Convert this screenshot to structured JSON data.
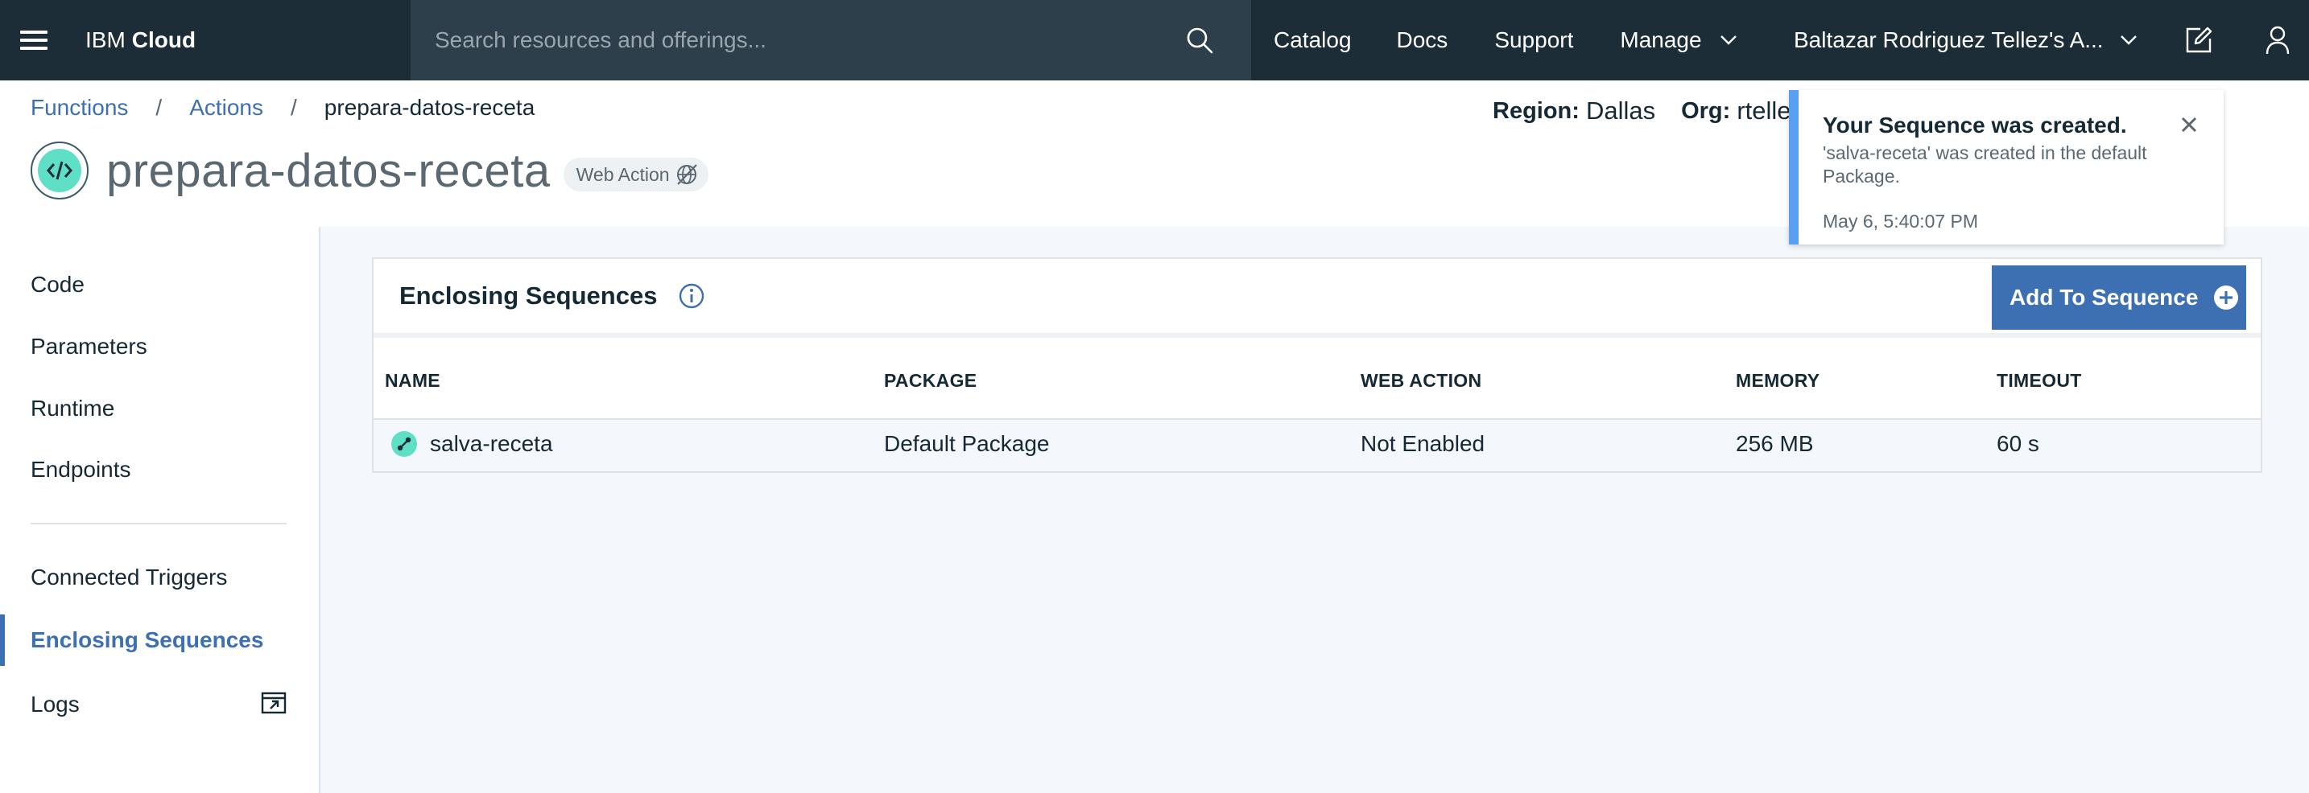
{
  "topbar": {
    "brand_light": "IBM",
    "brand_bold": "Cloud",
    "search_placeholder": "Search resources and offerings...",
    "nav": [
      "Catalog",
      "Docs",
      "Support",
      "Manage"
    ],
    "account": "Baltazar Rodriguez Tellez's A...",
    "colors": {
      "bar": "#1c2d38",
      "search": "#2d3f4a"
    }
  },
  "breadcrumb": {
    "items": [
      "Functions",
      "Actions"
    ],
    "current": "prepara-datos-receta"
  },
  "header": {
    "title": "prepara-datos-receta",
    "badge": "Web Action",
    "region_label": "Region:",
    "region_value": "Dallas",
    "org_label": "Org:",
    "org_value": "rtellez"
  },
  "sidebar": {
    "items": [
      "Code",
      "Parameters",
      "Runtime",
      "Endpoints"
    ],
    "items2": [
      "Connected Triggers",
      "Enclosing Sequences",
      "Logs"
    ],
    "active": "Enclosing Sequences"
  },
  "panel": {
    "title": "Enclosing Sequences",
    "add_button": "Add To Sequence",
    "columns": [
      "NAME",
      "PACKAGE",
      "WEB ACTION",
      "MEMORY",
      "TIMEOUT"
    ],
    "rows": [
      {
        "name": "salva-receta",
        "package": "Default Package",
        "web_action": "Not Enabled",
        "memory": "256 MB",
        "timeout": "60 s"
      }
    ]
  },
  "toast": {
    "title": "Your Sequence was created.",
    "message": "'salva-receta' was created in the default Package.",
    "time": "May 6, 5:40:07 PM",
    "accent": "#5aa0f2"
  },
  "colors": {
    "link": "#3d70b2",
    "accent_icon": "#5fe0c6",
    "main_bg": "#f4f7fb"
  }
}
